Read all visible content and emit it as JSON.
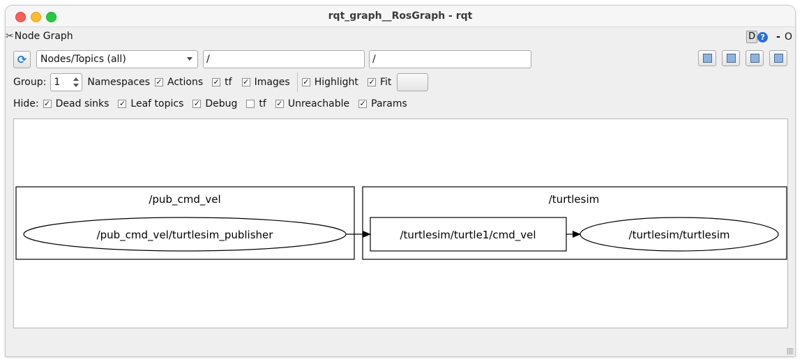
{
  "window": {
    "title": "rqt_graph__RosGraph - rqt"
  },
  "dock": {
    "title": "Node Graph",
    "d_button": "D",
    "help_button": "?",
    "minimize": "-",
    "close": "O"
  },
  "toolbar": {
    "mode_selected": "Nodes/Topics (all)",
    "filter_include": "/",
    "filter_exclude": "/"
  },
  "group_row": {
    "group_label": "Group:",
    "group_value": "1",
    "namespaces_label": "Namespaces",
    "checkboxes": [
      {
        "label": "Actions",
        "checked": true
      },
      {
        "label": "tf",
        "checked": true
      },
      {
        "label": "Images",
        "checked": true
      },
      {
        "label": "Highlight",
        "checked": true
      },
      {
        "label": "Fit",
        "checked": true
      }
    ]
  },
  "hide_row": {
    "hide_label": "Hide:",
    "checkboxes": [
      {
        "label": "Dead sinks",
        "checked": true
      },
      {
        "label": "Leaf topics",
        "checked": true
      },
      {
        "label": "Debug",
        "checked": true
      },
      {
        "label": "tf",
        "checked": false
      },
      {
        "label": "Unreachable",
        "checked": true
      },
      {
        "label": "Params",
        "checked": true
      }
    ]
  },
  "graph": {
    "clusters": [
      {
        "label": "/pub_cmd_vel"
      },
      {
        "label": "/turtlesim"
      }
    ],
    "nodes": [
      {
        "label": "/pub_cmd_vel/turtlesim_publisher",
        "shape": "ellipse"
      },
      {
        "label": "/turtlesim/turtle1/cmd_vel",
        "shape": "box"
      },
      {
        "label": "/turtlesim/turtlesim",
        "shape": "ellipse"
      }
    ]
  }
}
